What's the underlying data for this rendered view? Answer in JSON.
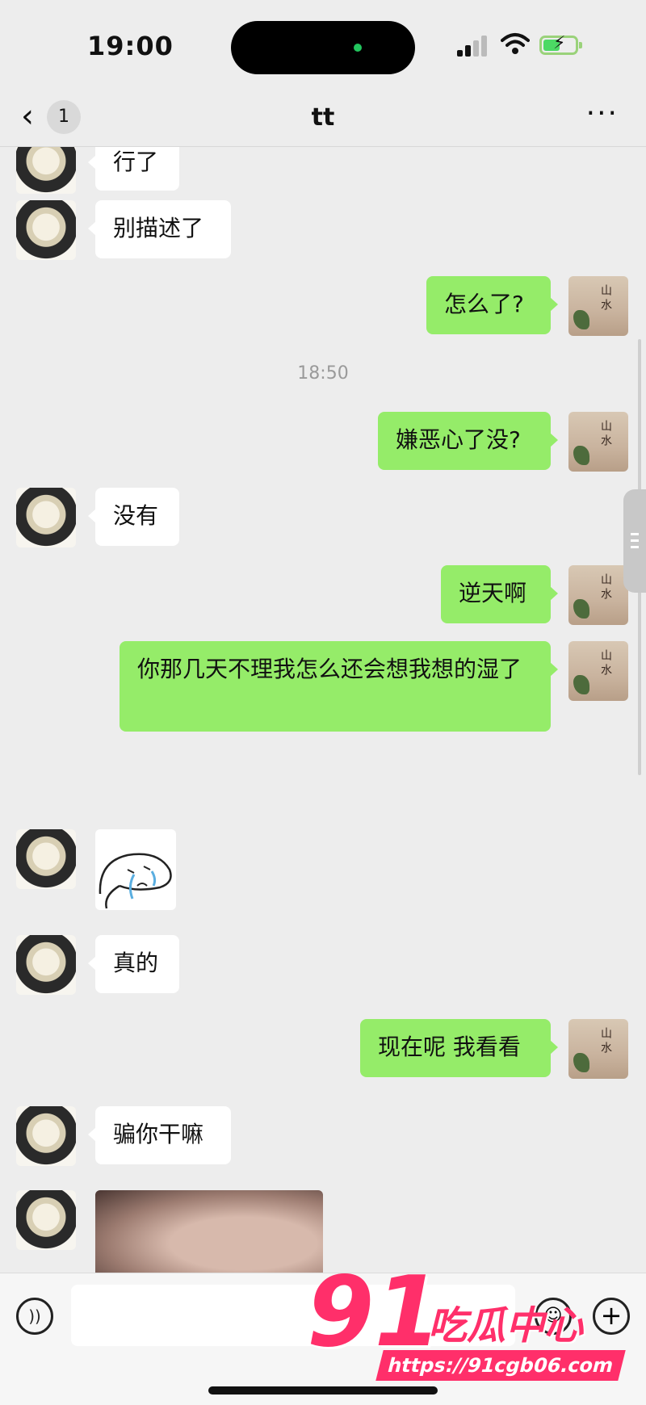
{
  "status_bar": {
    "time": "19:00"
  },
  "nav": {
    "back_icon": "‹",
    "unread_count": "1",
    "title": "tt",
    "more_icon": "···"
  },
  "messages": [
    {
      "side": "left",
      "text": "行了"
    },
    {
      "side": "left",
      "text": "别描述了"
    },
    {
      "side": "right",
      "text": "怎么了?"
    },
    {
      "type": "timestamp",
      "text": "18:50"
    },
    {
      "side": "right",
      "text": "嫌恶心了没?"
    },
    {
      "side": "left",
      "text": "没有"
    },
    {
      "side": "right",
      "text": "逆天啊"
    },
    {
      "side": "right",
      "text": "你那几天不理我怎么还会想我想的湿了"
    },
    {
      "side": "left",
      "type": "sticker",
      "text": ""
    },
    {
      "side": "left",
      "text": "真的"
    },
    {
      "side": "right",
      "text": "现在呢 我看看"
    },
    {
      "side": "left",
      "text": "骗你干嘛"
    },
    {
      "side": "left",
      "type": "image",
      "text": ""
    }
  ],
  "input_bar": {
    "placeholder": "",
    "voice_icon": "voice-icon",
    "emoji_icon": "emoji-icon",
    "plus_icon": "plus-icon"
  },
  "watermark": {
    "number": "91",
    "name": "吃瓜中心",
    "url": "https://91cgb06.com"
  },
  "colors": {
    "background": "#ededed",
    "sent_bubble": "#95ec69",
    "received_bubble": "#ffffff",
    "watermark": "#ff2f6a"
  }
}
